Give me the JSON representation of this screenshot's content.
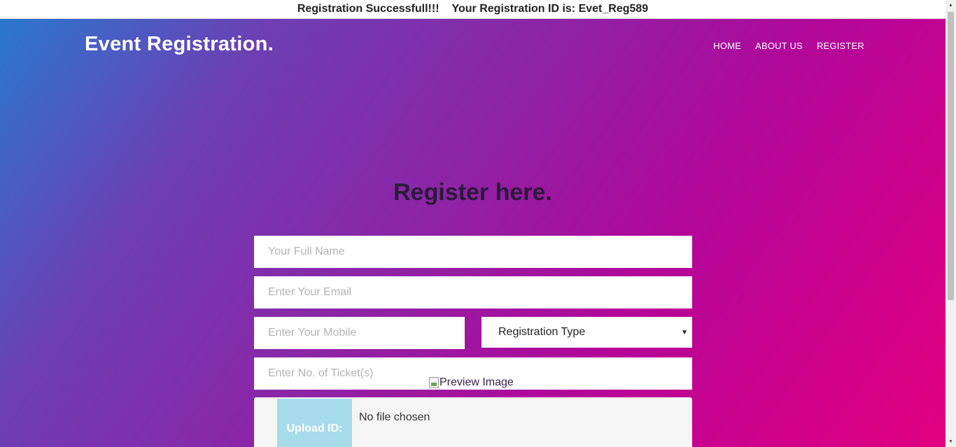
{
  "banner": {
    "success_text": "Registration Successfull!!!",
    "id_text": "Your Registration ID is: Evet_Reg589"
  },
  "header": {
    "brand": "Event Registration.",
    "nav": [
      "HOME",
      "ABOUT US",
      "REGISTER"
    ]
  },
  "form": {
    "title": "Register here.",
    "full_name_placeholder": "Your Full Name",
    "email_placeholder": "Enter Your Email",
    "mobile_placeholder": "Enter Your Mobile",
    "registration_type_selected": "Registration Type",
    "tickets_placeholder": "Enter No. of Ticket(s)",
    "preview_alt": "Preview Image",
    "upload_label": "Upload ID:",
    "file_status": "No file chosen"
  },
  "scrollbar": {
    "up_icon": "triangle-up",
    "down_icon": "triangle-down"
  },
  "colors": {
    "gradient_start": "#2a78d0",
    "gradient_mid": "#8d24a6",
    "gradient_end": "#e2007f",
    "upload_button": "#a6dbe9",
    "title_text": "#2a1a3a"
  }
}
